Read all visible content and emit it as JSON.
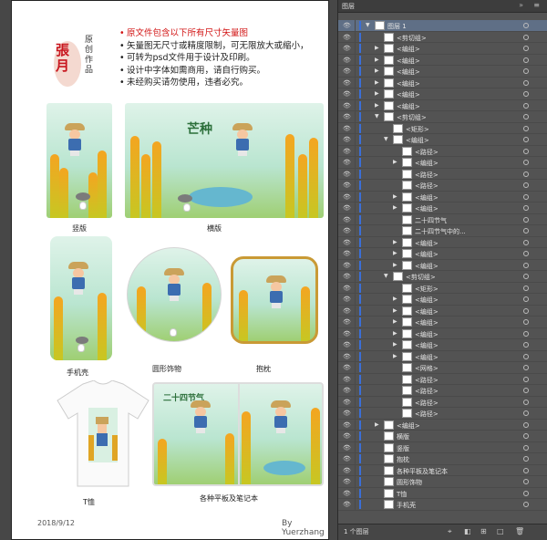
{
  "sheet": {
    "seal_calligraphy": "張月",
    "seal_vertical": "原创作品",
    "notes": [
      "原文件包含以下所有尺寸矢量图",
      "矢量图无尺寸或精度限制，可无限放大或缩小，",
      "可转为psd文件用于设计及印刷。",
      "设计中字体如需商用，请自行购买。",
      "未经购买请勿使用，违者必究。"
    ],
    "poster_title": "芒种",
    "poster_sub": "二十四节气",
    "captions": {
      "portrait": "竖版",
      "landscape": "横版",
      "phone": "手机壳",
      "round": "圆形饰物",
      "pillow": "抱枕",
      "tshirt": "T恤",
      "tablet": "各种平板及笔记本"
    },
    "footer_date": "2018/9/12",
    "footer_by": "By  Yuerzhang"
  },
  "panel": {
    "tab": "图层",
    "close": "»",
    "menu": "≡",
    "count_label": "1 个图层",
    "layers": [
      {
        "indent": 0,
        "arrow": "▼",
        "thumb": true,
        "label": "图层 1",
        "sel": true
      },
      {
        "indent": 1,
        "arrow": "",
        "thumb": true,
        "label": "<剪切组>"
      },
      {
        "indent": 1,
        "arrow": "▶",
        "thumb": true,
        "label": "<编组>"
      },
      {
        "indent": 1,
        "arrow": "▶",
        "thumb": true,
        "label": "<编组>"
      },
      {
        "indent": 1,
        "arrow": "▶",
        "thumb": true,
        "label": "<编组>"
      },
      {
        "indent": 1,
        "arrow": "▶",
        "thumb": true,
        "label": "<编组>"
      },
      {
        "indent": 1,
        "arrow": "▶",
        "thumb": true,
        "label": "<编组>"
      },
      {
        "indent": 1,
        "arrow": "▶",
        "thumb": true,
        "label": "<编组>"
      },
      {
        "indent": 1,
        "arrow": "▼",
        "thumb": true,
        "label": "<剪切组>"
      },
      {
        "indent": 2,
        "arrow": "",
        "thumb": true,
        "label": "<矩形>"
      },
      {
        "indent": 2,
        "arrow": "▼",
        "thumb": true,
        "label": "<编组>"
      },
      {
        "indent": 3,
        "arrow": "",
        "thumb": true,
        "label": "<路径>"
      },
      {
        "indent": 3,
        "arrow": "▶",
        "thumb": true,
        "label": "<编组>"
      },
      {
        "indent": 3,
        "arrow": "",
        "thumb": true,
        "label": "<路径>"
      },
      {
        "indent": 3,
        "arrow": "",
        "thumb": true,
        "label": "<路径>"
      },
      {
        "indent": 3,
        "arrow": "▶",
        "thumb": true,
        "label": "<编组>"
      },
      {
        "indent": 3,
        "arrow": "▶",
        "thumb": true,
        "label": "<编组>"
      },
      {
        "indent": 3,
        "arrow": "",
        "thumb": true,
        "label": "二十四节气"
      },
      {
        "indent": 3,
        "arrow": "",
        "thumb": true,
        "label": "二十四节气中的..."
      },
      {
        "indent": 3,
        "arrow": "▶",
        "thumb": true,
        "label": "<编组>"
      },
      {
        "indent": 3,
        "arrow": "▶",
        "thumb": true,
        "label": "<编组>"
      },
      {
        "indent": 3,
        "arrow": "▶",
        "thumb": true,
        "label": "<编组>"
      },
      {
        "indent": 2,
        "arrow": "▼",
        "thumb": true,
        "label": "<剪切组>"
      },
      {
        "indent": 3,
        "arrow": "",
        "thumb": true,
        "label": "<矩形>"
      },
      {
        "indent": 3,
        "arrow": "▶",
        "thumb": true,
        "label": "<编组>"
      },
      {
        "indent": 3,
        "arrow": "▶",
        "thumb": true,
        "label": "<编组>"
      },
      {
        "indent": 3,
        "arrow": "▶",
        "thumb": true,
        "label": "<编组>"
      },
      {
        "indent": 3,
        "arrow": "▶",
        "thumb": true,
        "label": "<编组>"
      },
      {
        "indent": 3,
        "arrow": "▶",
        "thumb": true,
        "label": "<编组>"
      },
      {
        "indent": 3,
        "arrow": "▶",
        "thumb": true,
        "label": "<编组>"
      },
      {
        "indent": 3,
        "arrow": "",
        "thumb": true,
        "label": "<网格>"
      },
      {
        "indent": 3,
        "arrow": "",
        "thumb": true,
        "label": "<路径>"
      },
      {
        "indent": 3,
        "arrow": "",
        "thumb": true,
        "label": "<路径>"
      },
      {
        "indent": 3,
        "arrow": "",
        "thumb": true,
        "label": "<路径>"
      },
      {
        "indent": 3,
        "arrow": "",
        "thumb": true,
        "label": "<路径>"
      },
      {
        "indent": 1,
        "arrow": "▶",
        "thumb": true,
        "label": "<编组>"
      },
      {
        "indent": 1,
        "arrow": "",
        "thumb": true,
        "label": "横版"
      },
      {
        "indent": 1,
        "arrow": "",
        "thumb": true,
        "label": "竖版"
      },
      {
        "indent": 1,
        "arrow": "",
        "thumb": true,
        "label": "抱枕"
      },
      {
        "indent": 1,
        "arrow": "",
        "thumb": true,
        "label": "各种平板及笔记本"
      },
      {
        "indent": 1,
        "arrow": "",
        "thumb": true,
        "label": "圆形饰物"
      },
      {
        "indent": 1,
        "arrow": "",
        "thumb": true,
        "label": "T恤"
      },
      {
        "indent": 1,
        "arrow": "",
        "thumb": true,
        "label": "手机壳"
      }
    ]
  }
}
